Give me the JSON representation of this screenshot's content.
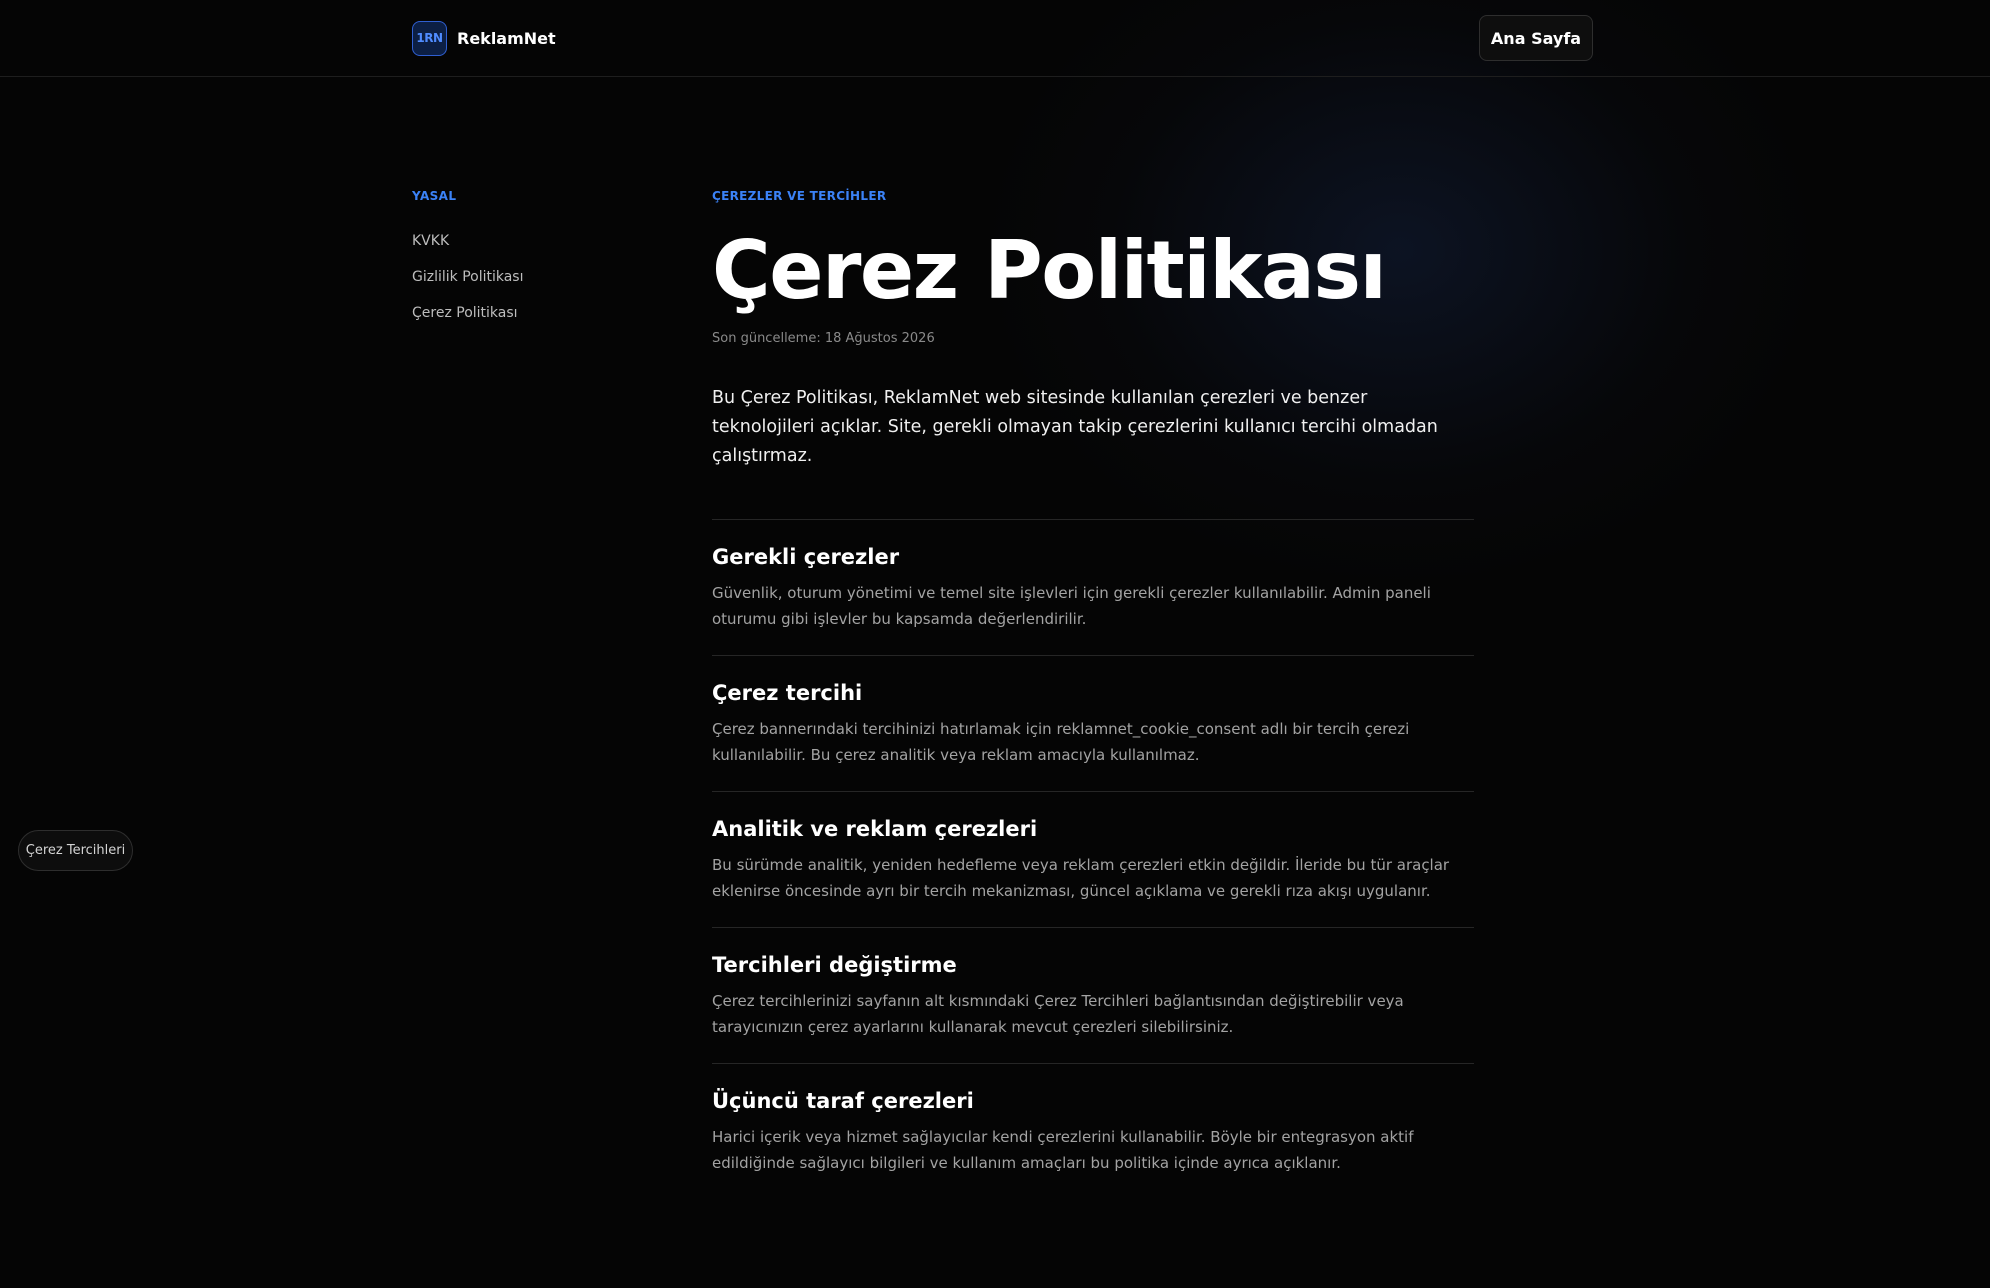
{
  "header": {
    "logo_text": "1RN",
    "brand_name": "ReklamNet",
    "home_label": "Ana Sayfa"
  },
  "sidebar": {
    "heading": "YASAL",
    "items": [
      {
        "label": "KVKK"
      },
      {
        "label": "Gizlilik Politikası"
      },
      {
        "label": "Çerez Politikası"
      }
    ]
  },
  "main": {
    "eyebrow": "ÇEREZLER VE TERCİHLER",
    "title": "Çerez Politikası",
    "updated": "Son güncelleme: 18 Ağustos 2026",
    "intro": "Bu Çerez Politikası, ReklamNet web sitesinde kullanılan çerezleri ve benzer teknolojileri açıklar. Site, gerekli olmayan takip çerezlerini kullanıcı tercihi olmadan çalıştırmaz.",
    "sections": [
      {
        "heading": "Gerekli çerezler",
        "body": "Güvenlik, oturum yönetimi ve temel site işlevleri için gerekli çerezler kullanılabilir. Admin paneli oturumu gibi işlevler bu kapsamda değerlendirilir."
      },
      {
        "heading": "Çerez tercihi",
        "body": "Çerez bannerındaki tercihinizi hatırlamak için reklamnet_cookie_consent adlı bir tercih çerezi kullanılabilir. Bu çerez analitik veya reklam amacıyla kullanılmaz."
      },
      {
        "heading": "Analitik ve reklam çerezleri",
        "body": "Bu sürümde analitik, yeniden hedefleme veya reklam çerezleri etkin değildir. İleride bu tür araçlar eklenirse öncesinde ayrı bir tercih mekanizması, güncel açıklama ve gerekli rıza akışı uygulanır."
      },
      {
        "heading": "Tercihleri değiştirme",
        "body": "Çerez tercihlerinizi sayfanın alt kısmındaki Çerez Tercihleri bağlantısından değiştirebilir veya tarayıcınızın çerez ayarlarını kullanarak mevcut çerezleri silebilirsiniz."
      },
      {
        "heading": "Üçüncü taraf çerezleri",
        "body": "Harici içerik veya hizmet sağlayıcılar kendi çerezlerini kullanabilir. Böyle bir entegrasyon aktif edildiğinde sağlayıcı bilgileri ve kullanım amaçları bu politika içinde ayrıca açıklanır."
      }
    ]
  },
  "cookie_preferences_button": "Çerez Tercihleri",
  "colors": {
    "background": "#050505",
    "accent": "#3b82f6",
    "text": "#ffffff",
    "muted_text": "#a3a3a3"
  }
}
